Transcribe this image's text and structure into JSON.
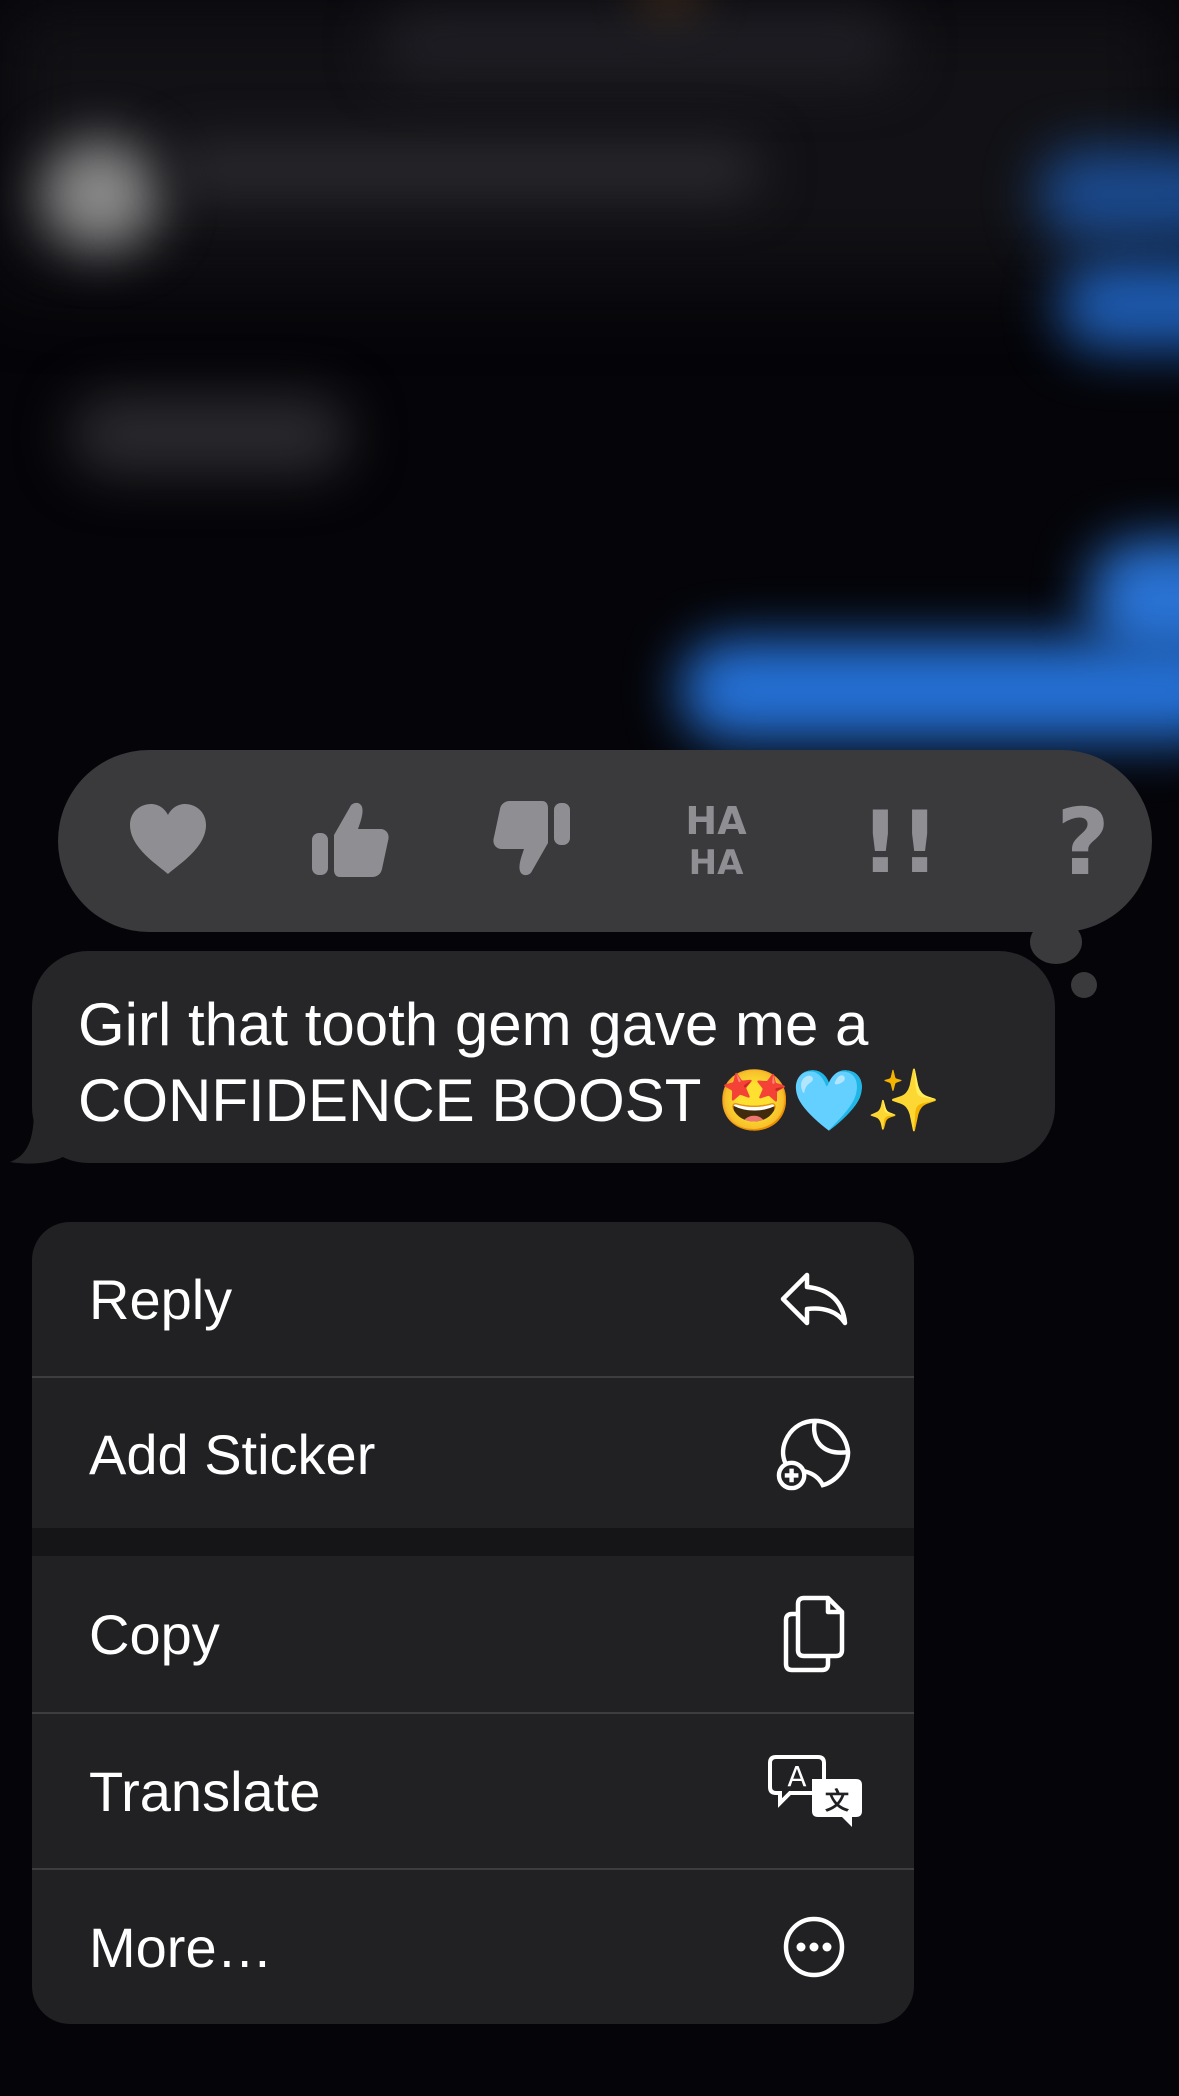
{
  "tapbacks": [
    {
      "name": "heart",
      "icon": "heart-icon"
    },
    {
      "name": "thumbs-up",
      "icon": "thumbs-up-icon"
    },
    {
      "name": "thumbs-down",
      "icon": "thumbs-down-icon"
    },
    {
      "name": "haha",
      "icon": "haha-icon",
      "text_top": "HA",
      "text_bottom": "HA"
    },
    {
      "name": "emphasize",
      "icon": "double-exclamation-icon",
      "text": "!!"
    },
    {
      "name": "question",
      "icon": "question-mark-icon",
      "text": "?"
    }
  ],
  "message": {
    "line1": "Girl that tooth gem gave me a",
    "line2": "CONFIDENCE BOOST 🤩🩵✨"
  },
  "menu": {
    "items": [
      {
        "label": "Reply",
        "icon": "reply-icon"
      },
      {
        "label": "Add Sticker",
        "icon": "add-sticker-icon"
      },
      {
        "label": "Copy",
        "icon": "copy-icon"
      },
      {
        "label": "Translate",
        "icon": "translate-icon"
      },
      {
        "label": "More…",
        "icon": "more-icon"
      }
    ]
  },
  "colors": {
    "background": "#050509",
    "tapback_bar": "#3a3a3c",
    "tapback_icon": "#8e8e93",
    "bubble": "#262629",
    "menu": "#212123",
    "separator": "#3d3d40",
    "blurred_blue": "#2571d6"
  }
}
